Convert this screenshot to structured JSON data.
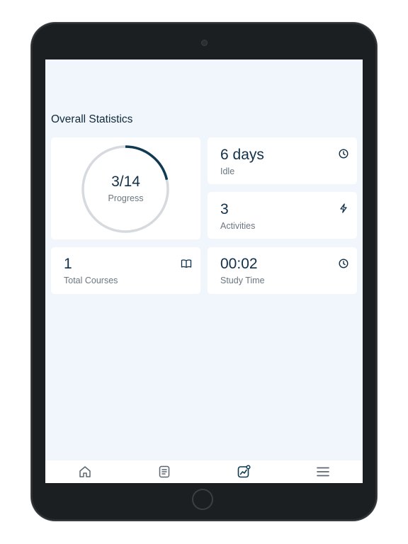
{
  "page": {
    "title": "Overall Statistics"
  },
  "progress": {
    "value": "3/14",
    "label": "Progress",
    "completed": 3,
    "total": 14
  },
  "stats": {
    "idle": {
      "value": "6 days",
      "label": "Idle",
      "icon": "clock-icon"
    },
    "activities": {
      "value": "3",
      "label": "Activities",
      "icon": "lightning-icon"
    },
    "total_courses": {
      "value": "1",
      "label": "Total Courses",
      "icon": "book-icon"
    },
    "study_time": {
      "value": "00:02",
      "label": "Study Time",
      "icon": "clock-icon"
    }
  },
  "nav": {
    "items": [
      {
        "icon": "home-icon"
      },
      {
        "icon": "document-icon"
      },
      {
        "icon": "chart-icon",
        "active": true
      },
      {
        "icon": "menu-icon"
      }
    ]
  },
  "colors": {
    "accent": "#0f3a52",
    "ring_track": "#d6d9de",
    "screen_bg": "#f1f6fd",
    "card_bg": "#ffffff"
  }
}
